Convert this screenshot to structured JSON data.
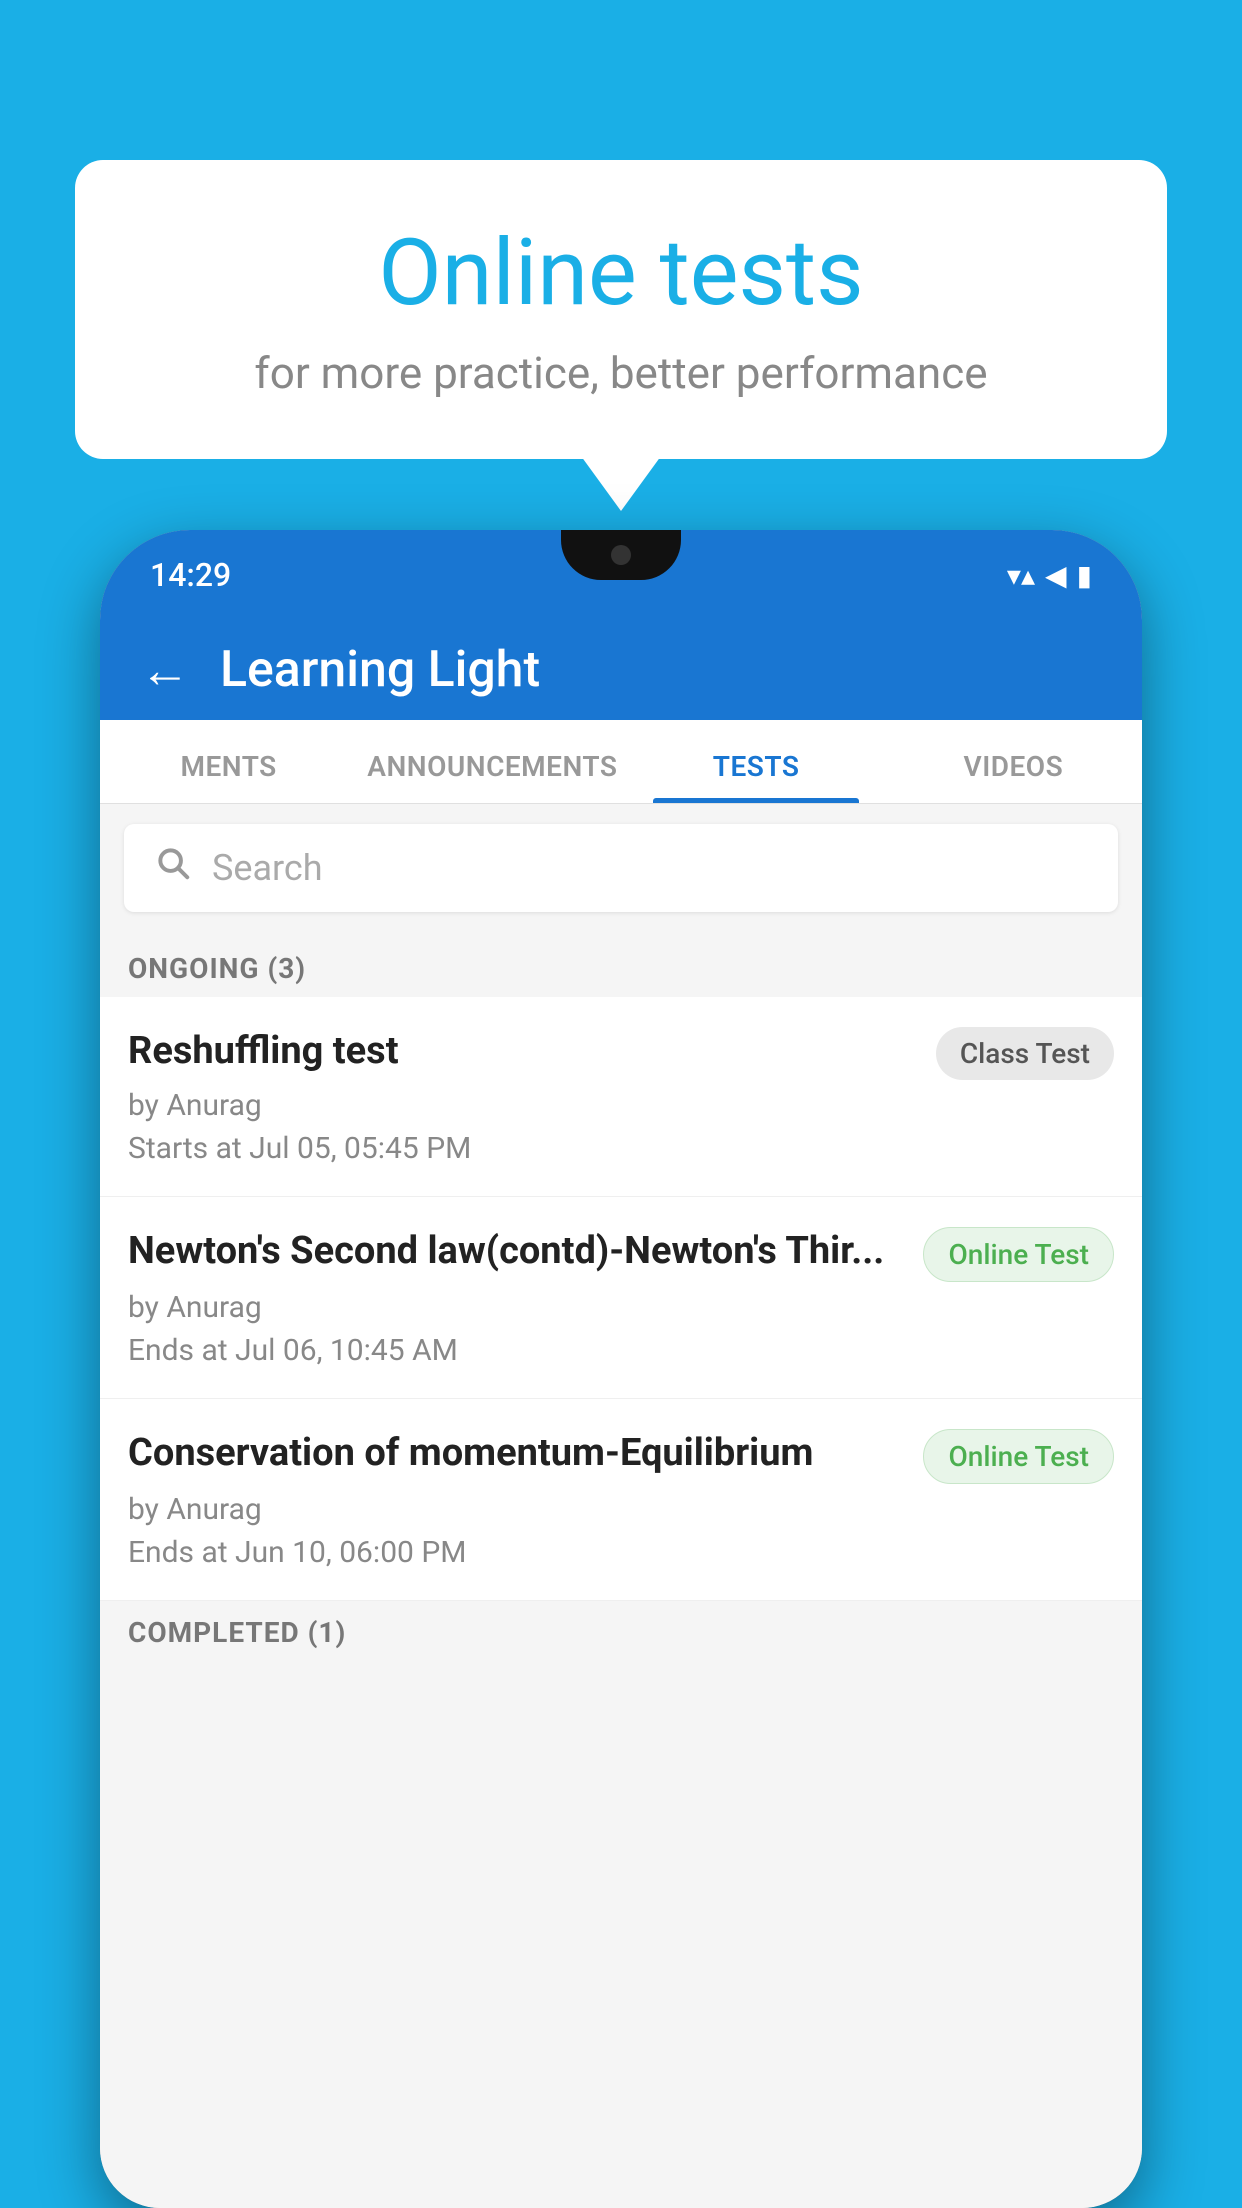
{
  "background": {
    "color": "#1AAFE6"
  },
  "speech_bubble": {
    "title": "Online tests",
    "subtitle": "for more practice, better performance"
  },
  "phone": {
    "status_bar": {
      "time": "14:29",
      "wifi": "▼▲",
      "signal": "◀",
      "battery": "▮"
    },
    "app_bar": {
      "back_label": "←",
      "title": "Learning Light"
    },
    "tabs": [
      {
        "label": "MENTS",
        "active": false
      },
      {
        "label": "ANNOUNCEMENTS",
        "active": false
      },
      {
        "label": "TESTS",
        "active": true
      },
      {
        "label": "VIDEOS",
        "active": false
      }
    ],
    "search": {
      "placeholder": "Search"
    },
    "ongoing_section": {
      "header": "ONGOING (3)"
    },
    "test_items": [
      {
        "title": "Reshuffling test",
        "badge": "Class Test",
        "badge_type": "class",
        "by": "by Anurag",
        "date": "Starts at  Jul 05, 05:45 PM"
      },
      {
        "title": "Newton's Second law(contd)-Newton's Thir...",
        "badge": "Online Test",
        "badge_type": "online",
        "by": "by Anurag",
        "date": "Ends at  Jul 06, 10:45 AM"
      },
      {
        "title": "Conservation of momentum-Equilibrium",
        "badge": "Online Test",
        "badge_type": "online",
        "by": "by Anurag",
        "date": "Ends at  Jun 10, 06:00 PM"
      }
    ],
    "completed_section": {
      "header": "COMPLETED (1)"
    }
  }
}
